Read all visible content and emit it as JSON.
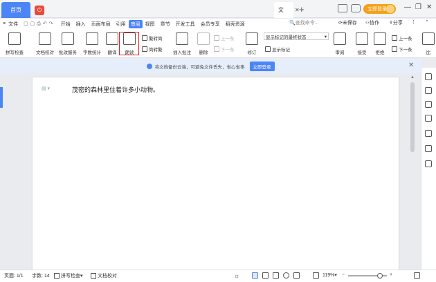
{
  "titlebar": {
    "home_tab": "首页",
    "pdf_icon": "pdf-icon",
    "doc_tab": "文",
    "login": "立即登录"
  },
  "menu": {
    "file": "文件",
    "items": [
      "开始",
      "插入",
      "页面布局",
      "引用",
      "审阅",
      "视图",
      "章节",
      "开发工具",
      "会员专享",
      "稻壳资源"
    ],
    "active": "审阅",
    "search": "查找命令...",
    "unsaved": "未保存",
    "collab": "协作",
    "share": "分享"
  },
  "ribbon": {
    "spell": "拼写检查",
    "proof": "文档校对",
    "batch": "批改服务",
    "wordcount": "字数统计",
    "translate": "翻译",
    "read": "朗读",
    "to_simplified": "繁转简",
    "to_traditional": "简转繁",
    "insert_comment": "插入批注",
    "delete": "删除",
    "prev": "上一条",
    "next": "下一条",
    "revise": "修订",
    "display_mode": "显示标记的最终状态",
    "show_markup": "显示标记",
    "review": "审阅",
    "accept": "接受",
    "reject": "拒绝",
    "prev2": "上一条",
    "next2": "下一条",
    "compare": "比"
  },
  "notice": {
    "text": "将文档备份云端，可避免文件丢失，省心省事",
    "button": "立即登录"
  },
  "document": {
    "text": "茂密的森林里住着许多小动物。"
  },
  "status": {
    "page": "页面: 1/1",
    "words": "字数: 14",
    "spell": "拼写检查",
    "proof": "文档校对",
    "zoom": "119%"
  },
  "colors": {
    "accent": "#4b85f6",
    "login": "#f6a01b",
    "highlight": "#e02020"
  }
}
